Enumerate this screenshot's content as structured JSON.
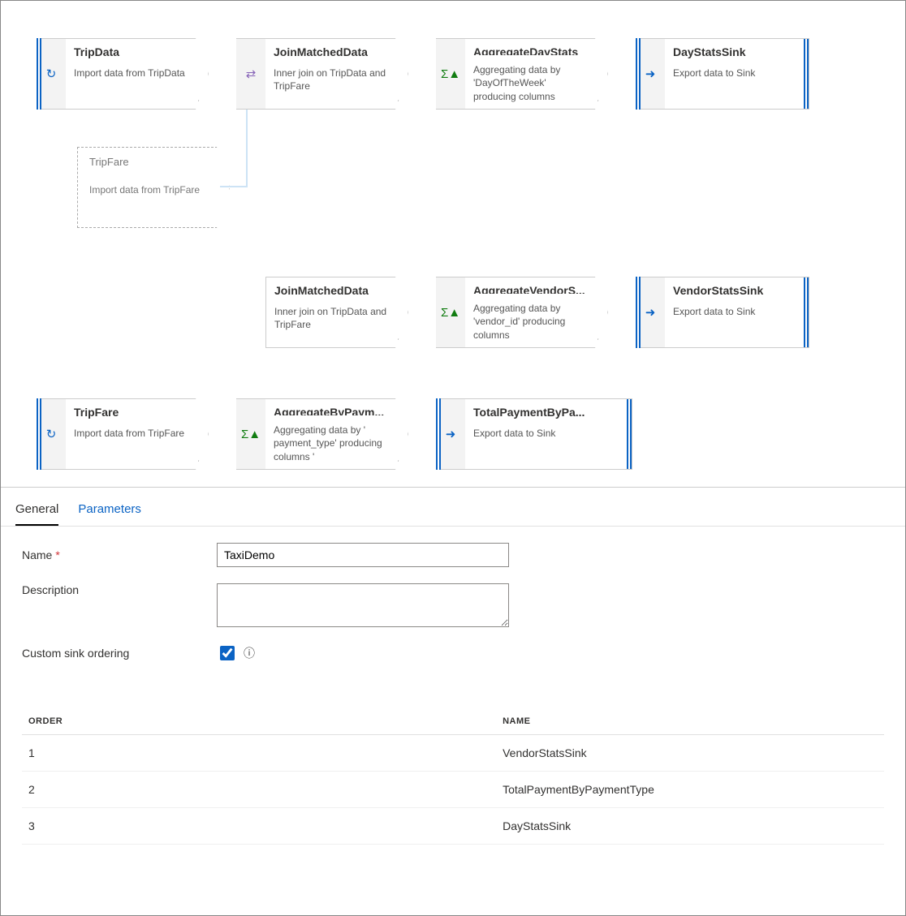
{
  "flow": {
    "row1": [
      {
        "id": "tripdata",
        "kind": "source",
        "icon": "↻",
        "title": "TripData",
        "desc": "Import data from TripData"
      },
      {
        "id": "join1",
        "kind": "join",
        "icon": "⇄",
        "title": "JoinMatchedData",
        "desc": "Inner join on TripData and TripFare"
      },
      {
        "id": "aggday",
        "kind": "agg",
        "icon": "Σ▲",
        "title": "AggregateDayStats",
        "desc": "Aggregating data by 'DayOfTheWeek' producing columns 'trip_distance..."
      },
      {
        "id": "daysink",
        "kind": "sink",
        "icon": "➜",
        "title": "DayStatsSink",
        "desc": "Export data to Sink"
      }
    ],
    "second_source": {
      "title": "TripFare",
      "desc": "Import data from TripFare"
    },
    "row2": [
      {
        "id": "join2",
        "kind": "join",
        "icon": "⇄",
        "title": "JoinMatchedData",
        "desc": "Inner join on TripData and TripFare"
      },
      {
        "id": "aggvend",
        "kind": "agg",
        "icon": "Σ▲",
        "title": "AggregateVendorS...",
        "desc": "Aggregating data by 'vendor_id' producing columns 'passenger_count..."
      },
      {
        "id": "vendsink",
        "kind": "sink",
        "icon": "➜",
        "title": "VendorStatsSink",
        "desc": "Export data to Sink"
      }
    ],
    "row3": [
      {
        "id": "tripfare2",
        "kind": "source",
        "icon": "↻",
        "title": "TripFare",
        "desc": "Import data from TripFare"
      },
      {
        "id": "aggpay",
        "kind": "agg",
        "icon": "Σ▲",
        "title": "AggregateByPaym...",
        "desc": "Aggregating data by ' payment_type' producing columns ' fare_amount_total..."
      },
      {
        "id": "paysink",
        "kind": "sink",
        "icon": "➜",
        "title": "TotalPaymentByPa...",
        "desc": "Export data to Sink"
      }
    ]
  },
  "tabs": {
    "general": "General",
    "parameters": "Parameters"
  },
  "form": {
    "name_label": "Name",
    "name_value": "TaxiDemo",
    "desc_label": "Description",
    "desc_value": "",
    "custom_label": "Custom sink ordering",
    "custom_checked": true
  },
  "order_table": {
    "cols": [
      "ORDER",
      "NAME"
    ],
    "rows": [
      {
        "order": "1",
        "name": "VendorStatsSink"
      },
      {
        "order": "2",
        "name": "TotalPaymentByPaymentType"
      },
      {
        "order": "3",
        "name": "DayStatsSink"
      }
    ]
  }
}
